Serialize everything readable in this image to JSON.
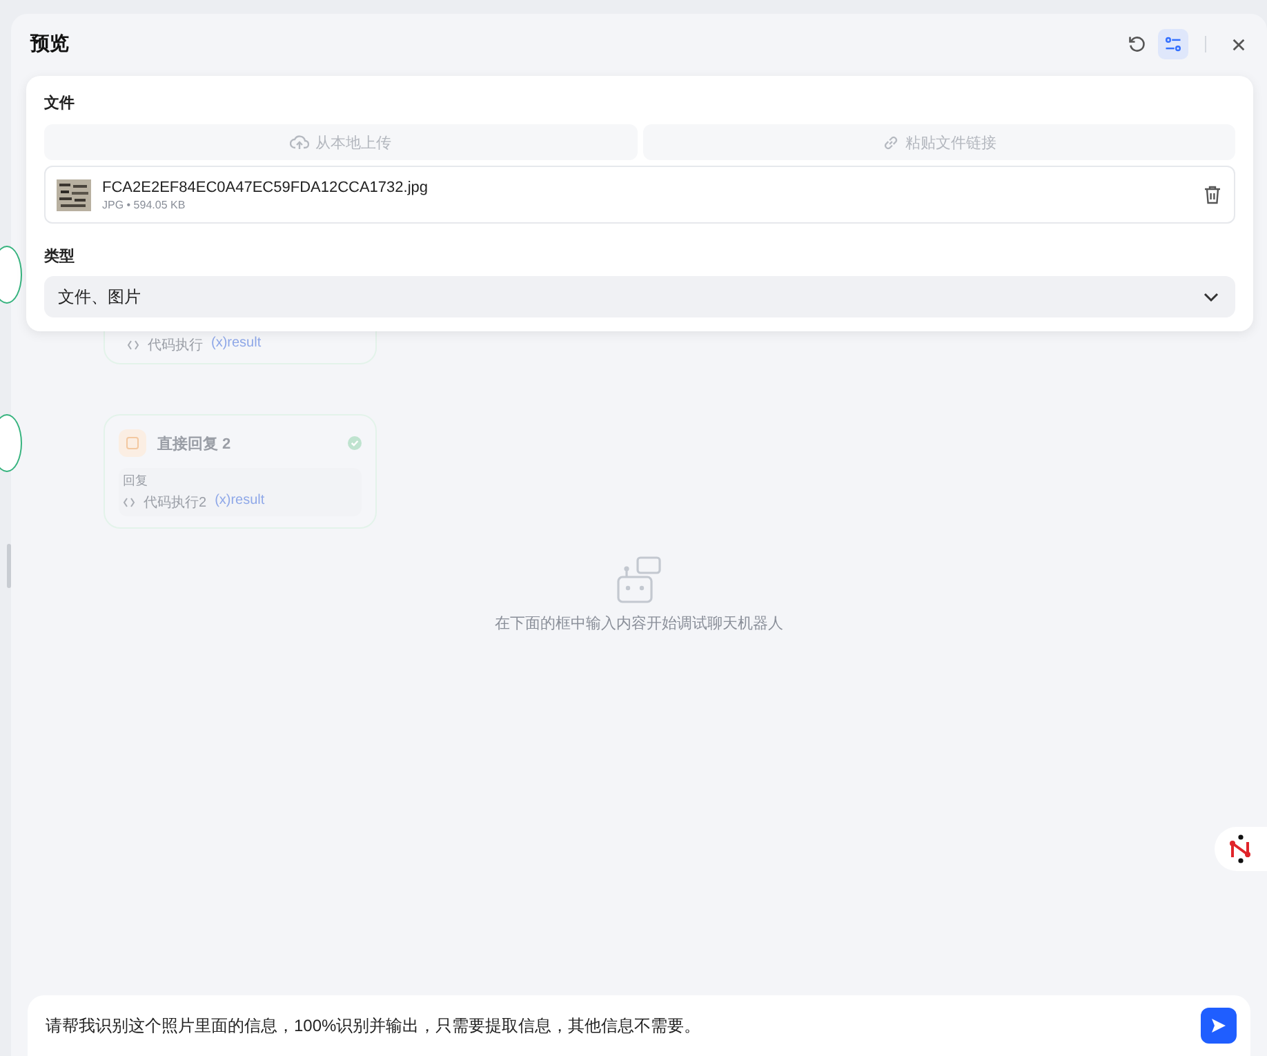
{
  "window": {
    "title": "预览"
  },
  "toolbar": [
    {
      "kind": "refresh",
      "selected": false
    },
    {
      "kind": "settings",
      "selected": true
    },
    {
      "kind": "close",
      "selected": false
    }
  ],
  "settings_panel": {
    "file_label": "文件",
    "upload_buttons": [
      {
        "kind": "upload",
        "label": "从本地上传"
      },
      {
        "kind": "link",
        "label": "粘贴文件链接"
      }
    ],
    "files": [
      {
        "name": "FCA2E2EF84EC0A47EC59FDA12CCA1732.jpg",
        "meta": "JPG • 594.05 KB"
      }
    ],
    "type_label": "类型",
    "type_select": {
      "value": "文件、图片"
    }
  },
  "canvas": {
    "nodes": [
      {
        "kind": "partial",
        "refs": [
          {
            "source": "代码执行",
            "variable": "(x)result"
          }
        ]
      },
      {
        "kind": "full",
        "title": "直接回复 2",
        "done": true,
        "field_label": "回复",
        "refs": [
          {
            "source": "代码执行2",
            "variable": "(x)result"
          }
        ]
      }
    ]
  },
  "empty_state": {
    "message": "在下面的框中输入内容开始调试聊天机器人"
  },
  "chat_input": {
    "value": "请帮我识别这个照片里面的信息，100%识别并输出，只需要提取信息，其他信息不需要。"
  }
}
